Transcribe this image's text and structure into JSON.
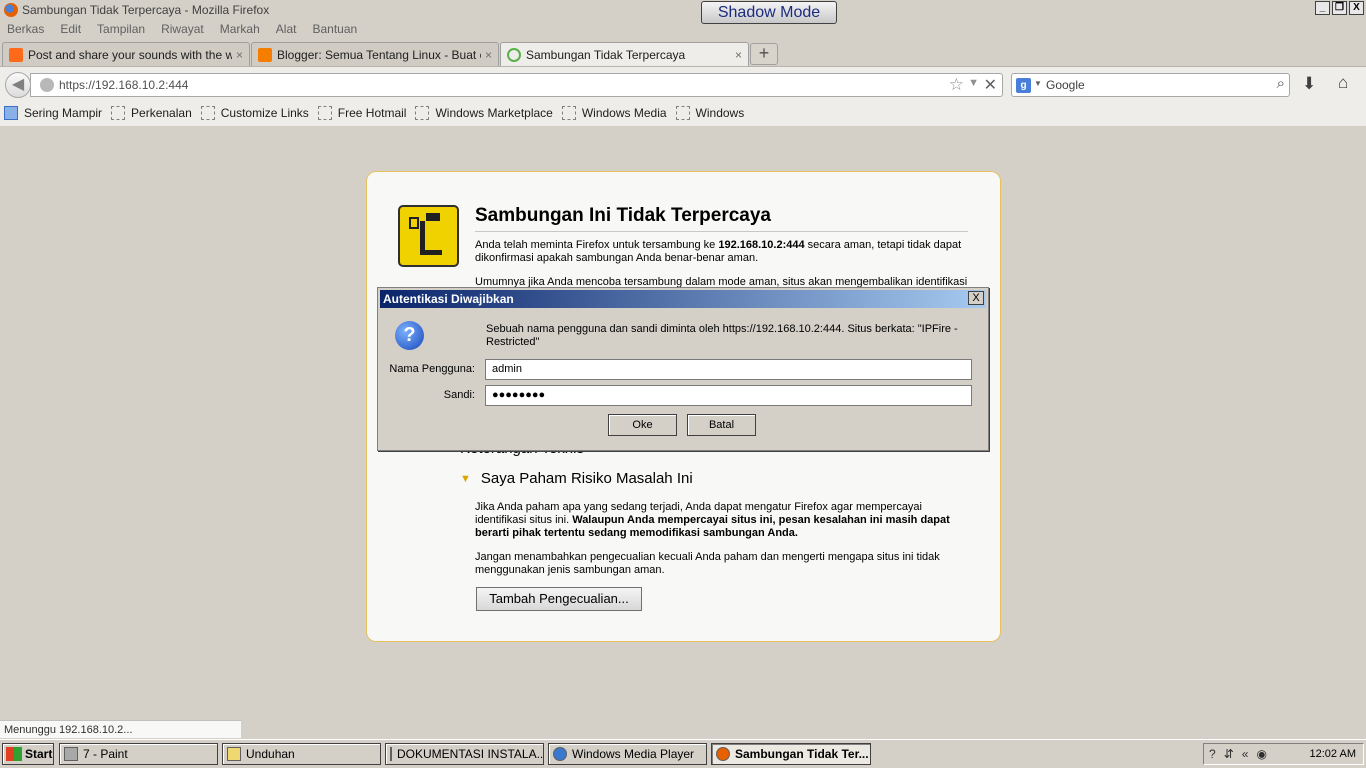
{
  "window": {
    "title": "Sambungan Tidak Terpercaya - Mozilla Firefox",
    "shadow_mode": "Shadow Mode",
    "buttons": [
      "_",
      "❐",
      "X"
    ]
  },
  "menu": [
    "Berkas",
    "Edit",
    "Tampilan",
    "Riwayat",
    "Markah",
    "Alat",
    "Bantuan"
  ],
  "tabs": [
    {
      "label": "Post and share your sounds with the wor...",
      "color": "#ff6a1a",
      "close": "×"
    },
    {
      "label": "Blogger: Semua Tentang Linux - Buat entri",
      "color": "#f57d00",
      "close": "×"
    },
    {
      "label": "Sambungan Tidak Terpercaya",
      "color": "#5ab04a",
      "close": "×"
    }
  ],
  "new_tab": "+",
  "nav": {
    "url": "https://192.168.10.2:444",
    "search_placeholder": "Google",
    "search_engine_letter": "g"
  },
  "bookmarks": [
    "Sering Mampir",
    "Perkenalan",
    "Customize Links",
    "Free Hotmail",
    "Windows Marketplace",
    "Windows Media",
    "Windows"
  ],
  "error_page": {
    "title": "Sambungan Ini Tidak Terpercaya",
    "p1_a": "Anda telah meminta Firefox untuk tersambung ke ",
    "p1_host": "192.168.10.2:444",
    "p1_b": " secara aman, tetapi tidak dapat dikonfirmasi apakah sambungan Anda benar-benar aman.",
    "p2": "Umumnya jika Anda mencoba tersambung dalam mode aman, situs akan mengembalikan identifikasi",
    "section_tech": "Keterangan Teknis",
    "section_risk": "Saya Paham Risiko Masalah Ini",
    "p3_a": "Jika Anda paham apa yang sedang terjadi, Anda dapat mengatur Firefox agar mempercayai identifikasi situs ini. ",
    "p3_bold": "Walaupun Anda mempercayai situs ini, pesan kesalahan ini masih dapat berarti pihak tertentu sedang memodifikasi sambungan Anda.",
    "p4": "Jangan menambahkan pengecualian kecuali Anda paham dan mengerti mengapa situs ini tidak menggunakan jenis sambungan aman.",
    "add_exception": "Tambah Pengecualian..."
  },
  "dialog": {
    "title": "Autentikasi Diwajibkan",
    "close": "X",
    "message": "Sebuah nama pengguna dan sandi diminta oleh https://192.168.10.2:444. Situs berkata: \"IPFire - Restricted\"",
    "user_label": "Nama Pengguna:",
    "user_value": "admin",
    "pass_label": "Sandi:",
    "pass_value": "●●●●●●●●",
    "ok": "Oke",
    "cancel": "Batal"
  },
  "status": "Menunggu 192.168.10.2...",
  "taskbar": {
    "start": "Start",
    "tasks": [
      "7 - Paint",
      "Unduhan",
      "DOKUMENTASI INSTALA...",
      "Windows Media Player",
      "Sambungan Tidak Ter..."
    ],
    "tray_icons": [
      "?",
      "«"
    ],
    "clock": "12:02 AM"
  }
}
